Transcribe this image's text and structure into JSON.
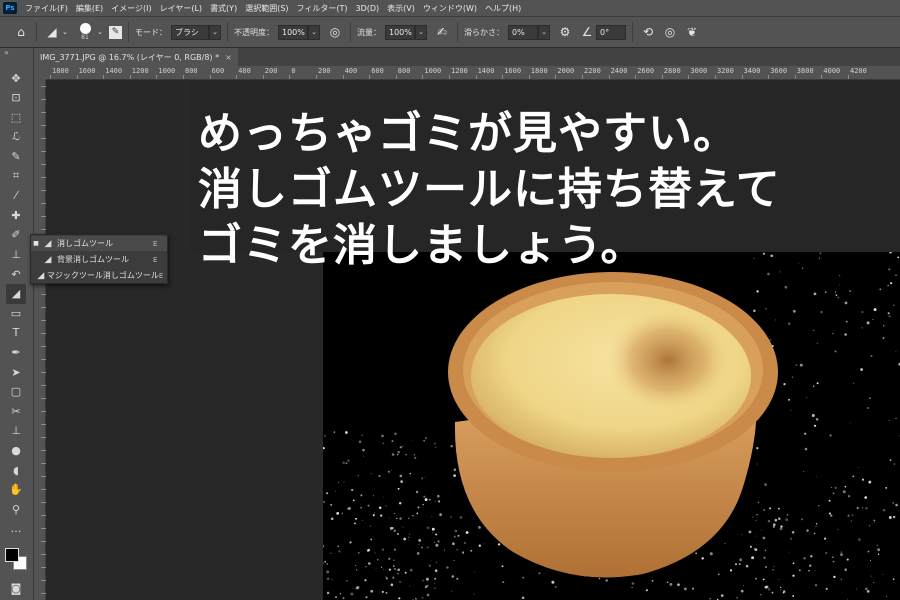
{
  "app": {
    "logo": "Ps"
  },
  "menu": [
    "ファイル(F)",
    "編集(E)",
    "イメージ(I)",
    "レイヤー(L)",
    "書式(Y)",
    "選択範囲(S)",
    "フィルター(T)",
    "3D(D)",
    "表示(V)",
    "ウィンドウ(W)",
    "ヘルプ(H)"
  ],
  "options": {
    "brush_size": "81",
    "mode_label": "モード：",
    "mode_value": "ブラシ",
    "opacity_label": "不透明度：",
    "opacity_value": "100%",
    "flow_label": "流量：",
    "flow_value": "100%",
    "smoothing_label": "滑らかさ：",
    "smoothing_value": "0%",
    "angle_value": "0°"
  },
  "document": {
    "tab_title": "IMG_3771.JPG @ 16.7% (レイヤー 0, RGB/8) *",
    "close_glyph": "×"
  },
  "ruler": {
    "labels": [
      "1800",
      "1600",
      "1400",
      "1200",
      "1000",
      "800",
      "600",
      "400",
      "200",
      "0",
      "200",
      "400",
      "600",
      "800",
      "1000",
      "1200",
      "1400",
      "1600",
      "1800",
      "2000",
      "2200",
      "2400",
      "2600",
      "2800",
      "3000",
      "3200",
      "3400",
      "3600",
      "3800",
      "4000",
      "4200"
    ]
  },
  "tools": [
    {
      "name": "move-tool-icon",
      "glyph": "✥"
    },
    {
      "name": "artboard-tool-icon",
      "glyph": "⊡"
    },
    {
      "name": "marquee-tool-icon",
      "glyph": "⬚"
    },
    {
      "name": "lasso-tool-icon",
      "glyph": "ℒ"
    },
    {
      "name": "quick-select-tool-icon",
      "glyph": "✎"
    },
    {
      "name": "crop-tool-icon",
      "glyph": "⌗"
    },
    {
      "name": "eyedropper-tool-icon",
      "glyph": "⁄"
    },
    {
      "name": "spot-healing-tool-icon",
      "glyph": "✚"
    },
    {
      "name": "brush-tool-icon",
      "glyph": "✐"
    },
    {
      "name": "stamp-tool-icon",
      "glyph": "⊥"
    },
    {
      "name": "history-brush-tool-icon",
      "glyph": "↶"
    },
    {
      "name": "eraser-tool-icon",
      "glyph": "◢"
    },
    {
      "name": "gradient-tool-icon",
      "glyph": "▭"
    },
    {
      "name": "type-tool-icon",
      "glyph": "T"
    },
    {
      "name": "pen-tool-icon",
      "glyph": "✒"
    },
    {
      "name": "path-select-tool-icon",
      "glyph": "➤"
    },
    {
      "name": "rectangle-tool-icon",
      "glyph": "▢"
    },
    {
      "name": "puppet-warp-tool-icon",
      "glyph": "✂"
    },
    {
      "name": "stamp-2-tool-icon",
      "glyph": "⊥"
    },
    {
      "name": "blur-tool-icon",
      "glyph": "●"
    },
    {
      "name": "dodge-tool-icon",
      "glyph": "◖"
    },
    {
      "name": "hand-tool-icon",
      "glyph": "✋"
    },
    {
      "name": "zoom-tool-icon",
      "glyph": "⚲"
    },
    {
      "name": "more-tools-icon",
      "glyph": "…"
    }
  ],
  "flyout": [
    {
      "label": "消しゴムツール",
      "key": "E"
    },
    {
      "label": "背景消しゴムツール",
      "key": "E"
    },
    {
      "label": "マジックツール消しゴムツール",
      "key": "E"
    }
  ],
  "headline": [
    "めっちゃゴミが見やすい。",
    "消しゴムツールに持ち替えて",
    "ゴミを消しましょう。"
  ],
  "colors": {
    "menubar": "#535353",
    "workspace": "#282828",
    "tart_crust": "#c98a4a",
    "tart_filling": "#f1d98a"
  }
}
